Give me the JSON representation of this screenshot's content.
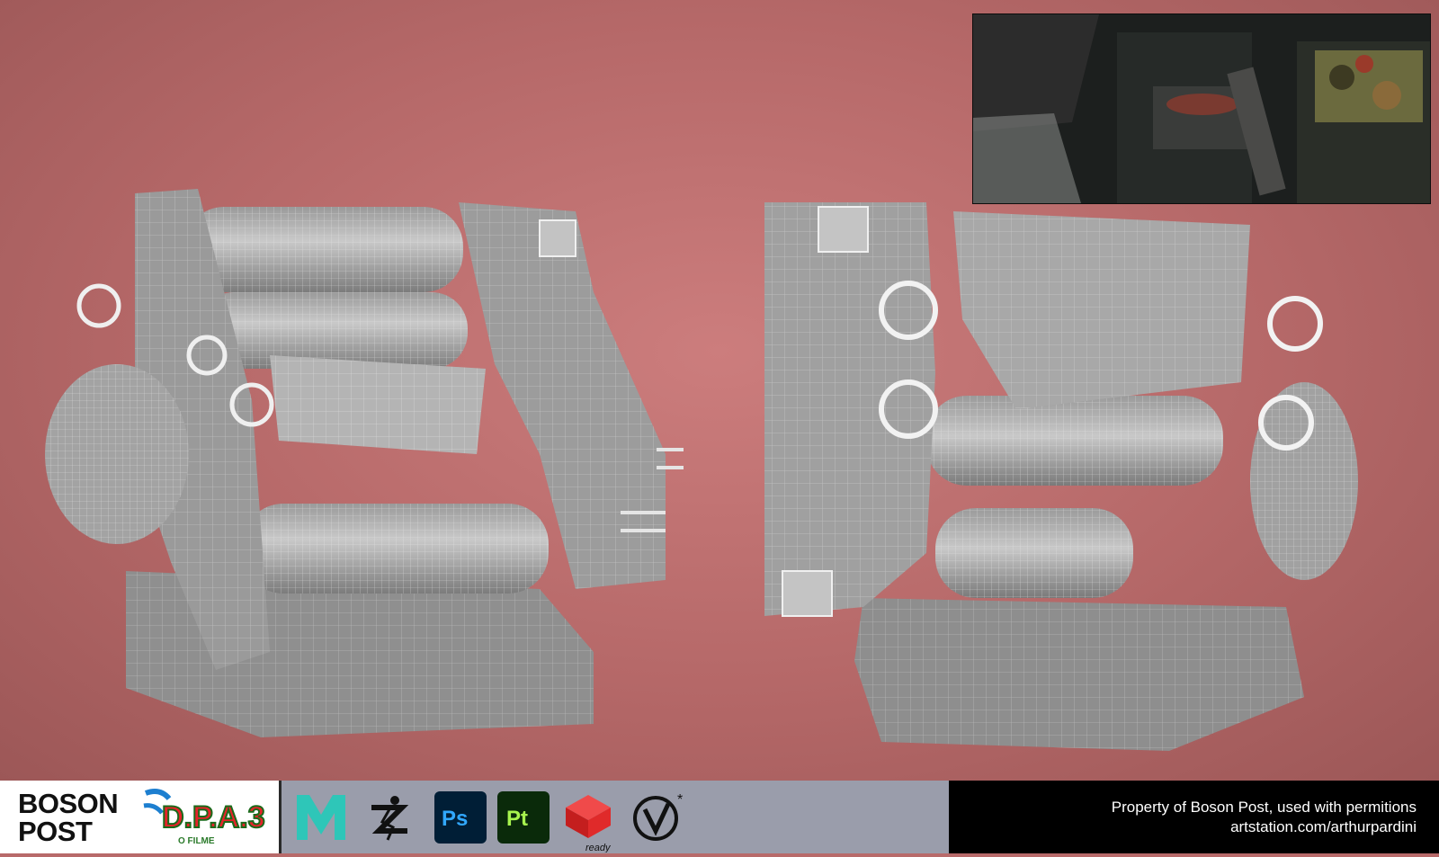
{
  "footer": {
    "boson_logo": {
      "line1": "BOSON",
      "line2": "POST"
    },
    "film_logo": {
      "main": "D.P.A.3",
      "sub": "O FILME"
    },
    "tools": [
      {
        "name": "maya-icon",
        "label": "M"
      },
      {
        "name": "zbrush-icon",
        "label": ""
      },
      {
        "name": "photoshop-icon",
        "label": "Ps"
      },
      {
        "name": "substance-painter-icon",
        "label": "Pt"
      },
      {
        "name": "redshift-icon",
        "label": "ready"
      },
      {
        "name": "vray-icon",
        "label": "*"
      }
    ],
    "credit_line1": "Property of Boson Post, used with permitions",
    "credit_line2": "artstation.com/arthurpardini"
  },
  "colors": {
    "background": "#b86a6a",
    "photoshop": "#001e36",
    "painter": "#0a2a0a",
    "maya_teal": "#2ec6b8"
  }
}
